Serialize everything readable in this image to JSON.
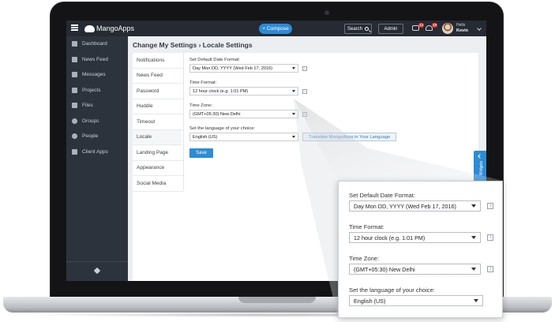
{
  "app": {
    "brand": "MangoApps",
    "compose_label": "Compose",
    "search_label": "Search",
    "admin_label": "Admin",
    "messages_badge": "13",
    "alerts_badge": "19",
    "user_greeting": "Hello",
    "user_name": "Kevin"
  },
  "sidebar": {
    "items": [
      {
        "label": "Dashboard",
        "icon": "dashboard-icon"
      },
      {
        "label": "News Feed",
        "icon": "news-icon"
      },
      {
        "label": "Messages",
        "icon": "envelope-icon"
      },
      {
        "label": "Projects",
        "icon": "projects-icon"
      },
      {
        "label": "Files",
        "icon": "files-icon"
      },
      {
        "label": "Groups",
        "icon": "groups-icon"
      },
      {
        "label": "People",
        "icon": "person-icon"
      },
      {
        "label": "Client Apps",
        "icon": "download-icon"
      }
    ]
  },
  "page": {
    "title": "Change My Settings › Locale Settings"
  },
  "settings_nav": [
    "Notifications",
    "News Feed",
    "Password",
    "Huddle",
    "Timeout",
    "Locale",
    "Landing Page",
    "Appearance",
    "Social Media"
  ],
  "settings_nav_active": "Locale",
  "form": {
    "date_format_label": "Set Default Date Format:",
    "date_format_value": "Day Mon DD, YYYY (Wed Feb 17, 2016)",
    "time_format_label": "Time Format:",
    "time_format_value": "12 hour clock (e.g. 1:01 PM)",
    "time_zone_label": "Time Zone:",
    "time_zone_value": "(GMT+05:30) New Delhi",
    "language_label": "Set the language of your choice:",
    "language_value": "English (US)",
    "translate_button": "Translate MangoApps in Your Language",
    "save_button": "Save",
    "info_glyph": "i"
  },
  "widgets_label": "Widgets",
  "colors": {
    "accent": "#2e8bd6",
    "topbar": "#252a33",
    "sidebar": "#2d333d",
    "badge": "#e53935"
  }
}
